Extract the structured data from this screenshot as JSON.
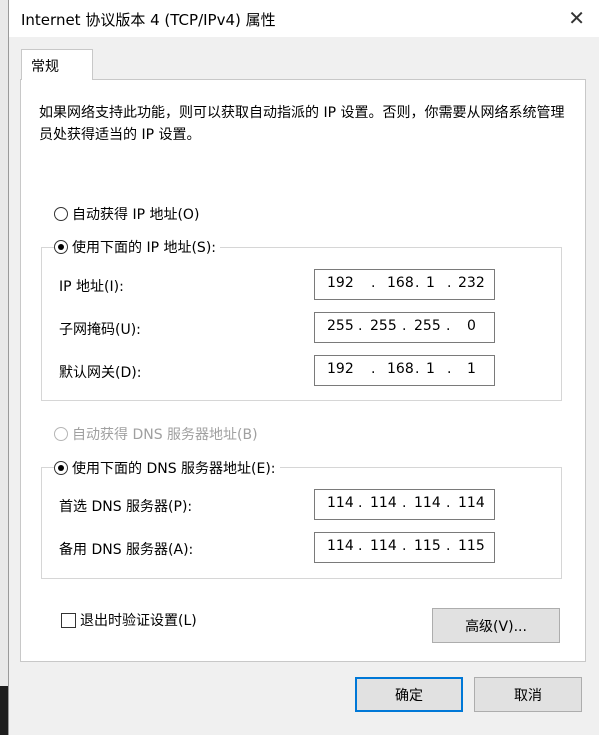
{
  "window": {
    "title": "Internet 协议版本 4 (TCP/IPv4) 属性",
    "close_glyph": "✕"
  },
  "tab": {
    "label": "常规"
  },
  "description": "如果网络支持此功能，则可以获取自动指派的 IP 设置。否则，你需要从网络系统管理员处获得适当的 IP 设置。",
  "ip": {
    "auto_label": "自动获得 IP 地址(O)",
    "auto_selected": false,
    "manual_label": "使用下面的 IP 地址(S):",
    "manual_selected": true,
    "address": {
      "label": "IP 地址(I):",
      "octets": [
        "192",
        "168",
        "1",
        "232"
      ]
    },
    "subnet": {
      "label": "子网掩码(U):",
      "octets": [
        "255",
        "255",
        "255",
        "0"
      ]
    },
    "gateway": {
      "label": "默认网关(D):",
      "octets": [
        "192",
        "168",
        "1",
        "1"
      ]
    }
  },
  "dns": {
    "auto_label": "自动获得 DNS 服务器地址(B)",
    "auto_enabled": false,
    "manual_label": "使用下面的 DNS 服务器地址(E):",
    "manual_selected": true,
    "preferred": {
      "label": "首选 DNS 服务器(P):",
      "octets": [
        "114",
        "114",
        "114",
        "114"
      ]
    },
    "alternate": {
      "label": "备用 DNS 服务器(A):",
      "octets": [
        "114",
        "114",
        "115",
        "115"
      ]
    }
  },
  "validate": {
    "label": "退出时验证设置(L)",
    "checked": false
  },
  "buttons": {
    "advanced": "高级(V)...",
    "ok": "确定",
    "cancel": "取消"
  },
  "colors": {
    "accent": "#0078d7",
    "panel": "#ffffff",
    "dialog": "#f0f0f0"
  }
}
